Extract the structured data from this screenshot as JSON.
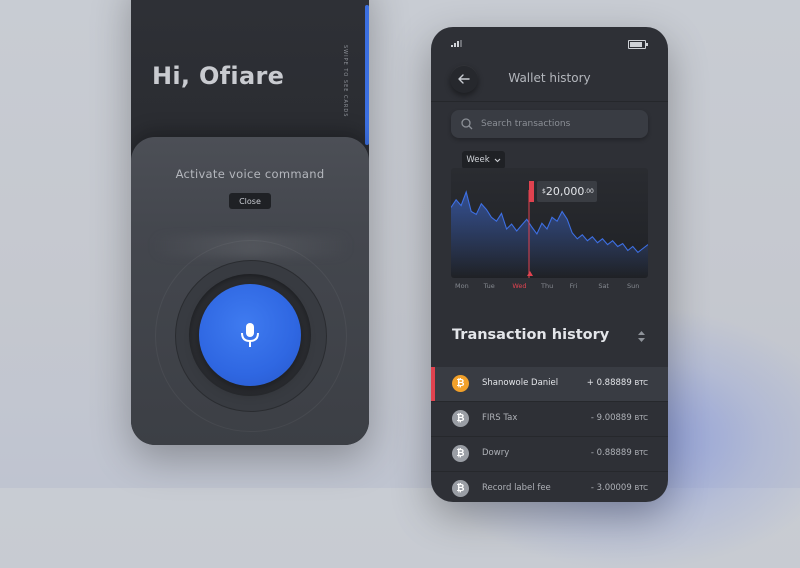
{
  "left_phone": {
    "greeting": "Hi, Ofiare",
    "swipe_hint": "SWIPE TO SEE CARDS",
    "voice_title": "Activate voice command",
    "close_label": "Close",
    "mic_icon": "microphone-icon",
    "accent_color": "#2f67e2"
  },
  "right_phone": {
    "header_title": "Wallet history",
    "back_icon": "arrow-left-icon",
    "search": {
      "placeholder": "Search transactions"
    },
    "period": {
      "selected": "Week"
    },
    "tooltip": {
      "currency": "$",
      "amount": "20,000",
      "cents": ".00"
    },
    "transaction_title": "Transaction history",
    "transactions": [
      {
        "name": "Shanowole Daniel",
        "amount": "+ 0.88889",
        "unit": "BTC",
        "icon": "bitcoin-icon",
        "active": true
      },
      {
        "name": "FIRS Tax",
        "amount": "- 9.00889",
        "unit": "BTC",
        "icon": "bitcoin-icon",
        "active": false
      },
      {
        "name": "Dowry",
        "amount": "- 0.88889",
        "unit": "BTC",
        "icon": "bitcoin-icon",
        "active": false
      },
      {
        "name": "Record label fee",
        "amount": "- 3.00009",
        "unit": "BTC",
        "icon": "bitcoin-icon",
        "active": false
      }
    ],
    "highlight_color": "#e0424f"
  },
  "chart_data": {
    "type": "area",
    "categories": [
      "Mon",
      "Tue",
      "Wed",
      "Thu",
      "Fri",
      "Sat",
      "Sun"
    ],
    "selected_category": "Wed",
    "selected_value_label": "$20,000.00",
    "series_color": "#3d6fe3",
    "series": [
      {
        "name": "",
        "values": [
          62,
          70,
          64,
          78,
          58,
          55,
          66,
          60,
          52,
          48,
          56,
          40,
          45,
          38,
          44,
          50,
          42,
          35,
          46,
          40,
          52,
          48,
          58,
          50,
          36,
          30,
          34,
          28,
          32,
          26,
          30,
          24,
          28,
          22,
          25,
          18,
          22,
          16,
          20,
          24
        ]
      }
    ]
  }
}
